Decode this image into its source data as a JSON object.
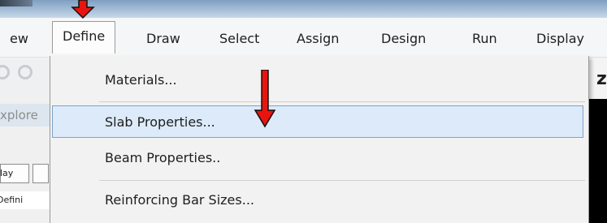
{
  "menubar": {
    "items": [
      {
        "label": "ew"
      },
      {
        "label": "Define"
      },
      {
        "label": "Draw"
      },
      {
        "label": "Select"
      },
      {
        "label": "Assign"
      },
      {
        "label": "Design"
      },
      {
        "label": "Run"
      },
      {
        "label": "Display"
      }
    ]
  },
  "define_menu": {
    "items": [
      {
        "label": "Materials..."
      },
      {
        "label": "Slab Properties..."
      },
      {
        "label": "Beam Properties.."
      },
      {
        "label": "Reinforcing Bar Sizes..."
      }
    ],
    "highlighted": "Slab Properties..."
  },
  "side_panel": {
    "explorer_label": "xplore",
    "tab_label": "play",
    "tree_item": "Defini"
  },
  "toolbar": {
    "zoom_glyph": "z"
  },
  "annotations": {
    "arrow_color": "#e8140f"
  },
  "colors": {
    "highlight_bg": "#dceaf9",
    "highlight_border": "#7da2ce"
  }
}
